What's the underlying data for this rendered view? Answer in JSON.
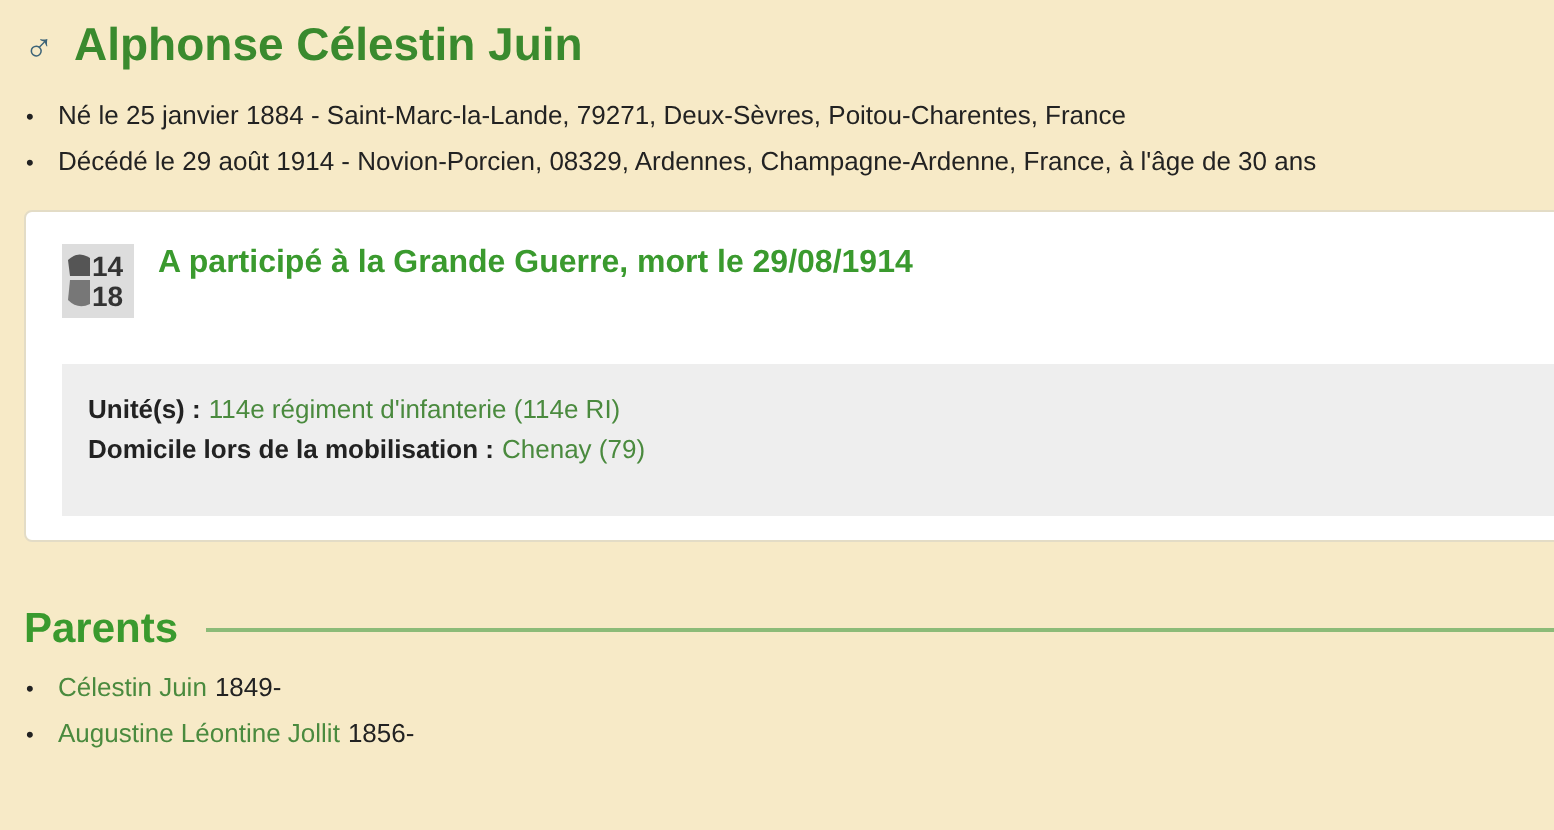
{
  "person": {
    "gender_symbol": "♂",
    "name": "Alphonse Célestin Juin"
  },
  "facts": [
    {
      "bullet": "•",
      "text": "Né le 25 janvier 1884 - Saint-Marc-la-Lande, 79271, Deux-Sèvres, Poitou-Charentes, France"
    },
    {
      "bullet": "•",
      "text": "Décédé le 29 août 1914 - Novion-Porcien, 08329, Ardennes, Champagne-Ardenne, France, à l'âge de 30 ans"
    }
  ],
  "war_card": {
    "badge": [
      "14",
      "18"
    ],
    "title": "A participé à la Grande Guerre, mort le 29/08/1914",
    "details": [
      {
        "label": "Unité(s) :",
        "value": "114e régiment d'infanterie (114e RI)"
      },
      {
        "label": "Domicile lors de la mobilisation :",
        "value": "Chenay (79)"
      }
    ]
  },
  "parents": {
    "heading": "Parents",
    "items": [
      {
        "bullet": "•",
        "name": "Célestin Juin",
        "years": "1849-"
      },
      {
        "bullet": "•",
        "name": "Augustine Léontine Jollit",
        "years": "1856-"
      }
    ]
  }
}
